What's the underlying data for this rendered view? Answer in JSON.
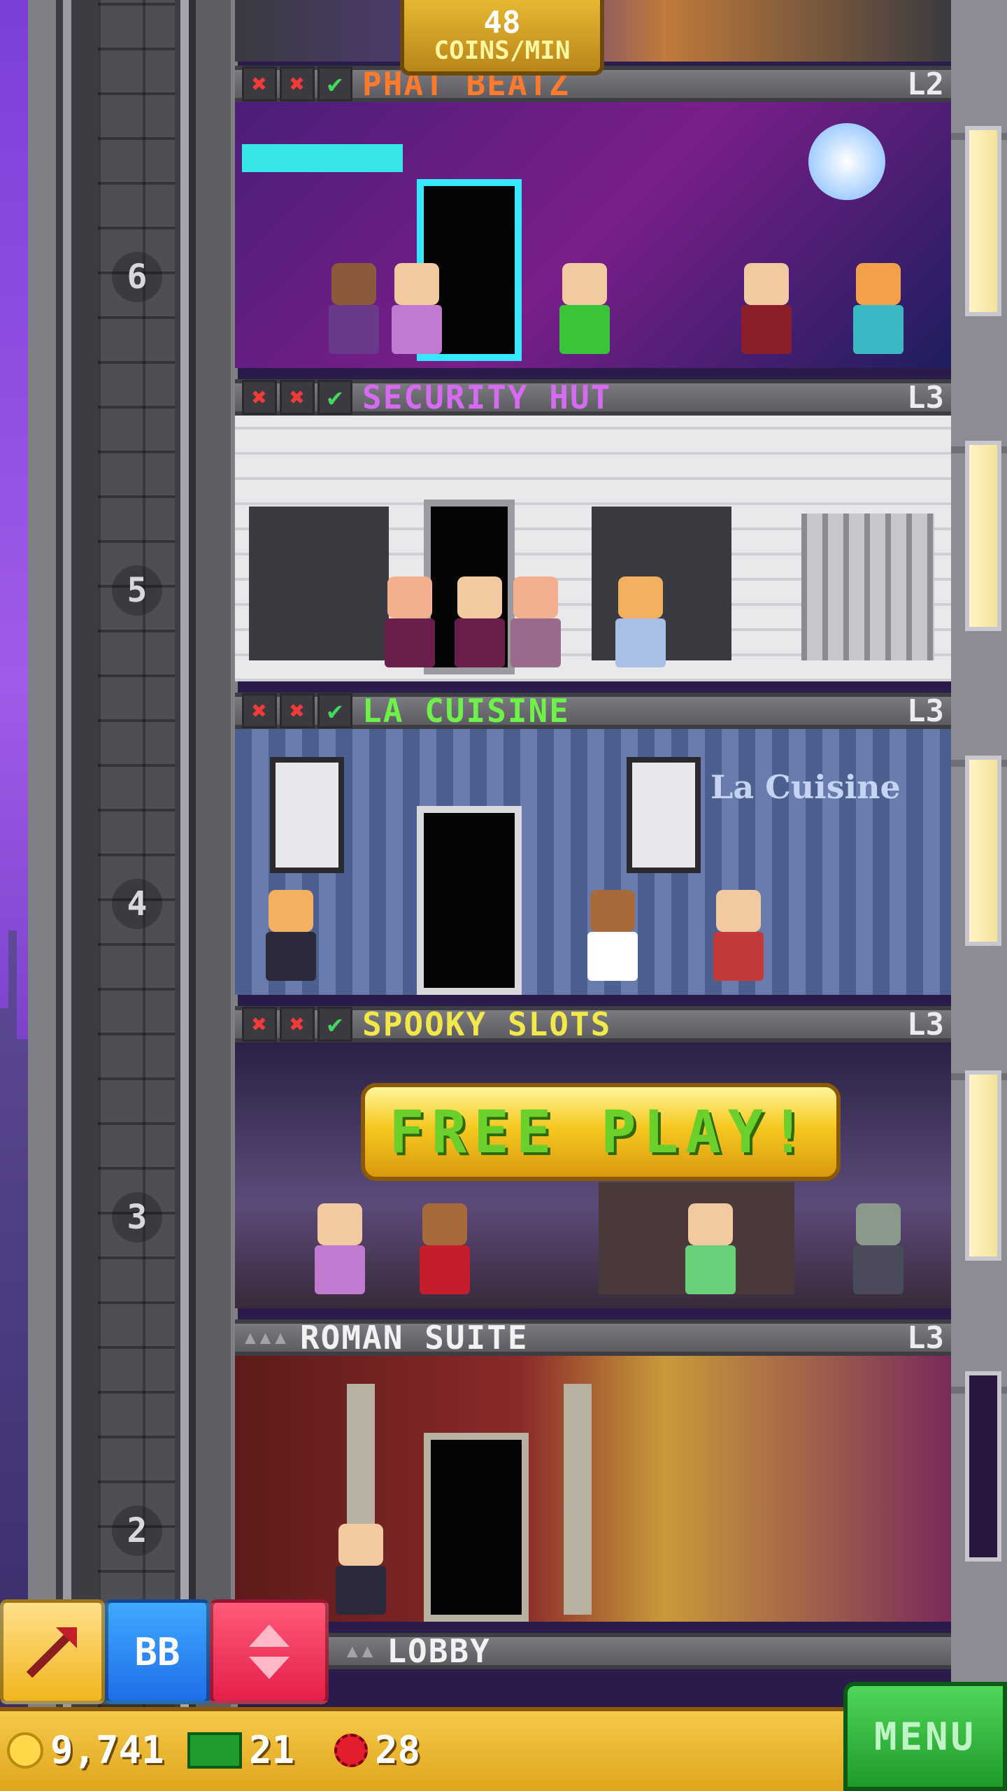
{
  "hud": {
    "coins_per_min_value": "48",
    "coins_per_min_unit": "COINS/MIN",
    "coins": "9,741",
    "bux": "21",
    "gems": "28",
    "menu_label": "MENU",
    "bb_label": "BB"
  },
  "floor_numbers": [
    "6",
    "5",
    "4",
    "3",
    "2"
  ],
  "floors": [
    {
      "name": "PHAT BEATZ",
      "level": "L2",
      "name_color": "#ff7a2a"
    },
    {
      "name": "SECURITY HUT",
      "level": "L3",
      "name_color": "#d66bf2"
    },
    {
      "name": "LA CUISINE",
      "level": "L3",
      "name_color": "#6ef24a"
    },
    {
      "name": "SPOOKY SLOTS",
      "level": "L3",
      "name_color": "#f2e84a"
    },
    {
      "name": "ROMAN SUITE",
      "level": "L3",
      "name_color": "#f2f2f2"
    },
    {
      "name": "LOBBY",
      "level": "",
      "name_color": "#f2f2f2"
    }
  ],
  "free_play_label": "FREE  PLAY!",
  "restaurant_sign": "La Cuisine",
  "icons": [
    "x-icon",
    "check-icon",
    "pickaxe-icon",
    "elevator-icon",
    "coin-icon",
    "cash-icon",
    "gem-icon"
  ]
}
